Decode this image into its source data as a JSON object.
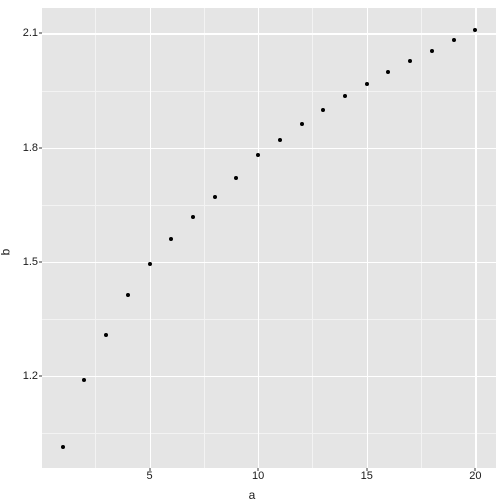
{
  "chart_data": {
    "type": "scatter",
    "xlabel": "a",
    "ylabel": "b",
    "xlim": [
      0.05,
      20.95
    ],
    "ylim": [
      0.958,
      2.167
    ],
    "x_ticks": [
      5,
      10,
      15,
      20
    ],
    "y_ticks": [
      1.2,
      1.5,
      1.8,
      2.1
    ],
    "x_minor": [
      2.5,
      7.5,
      12.5,
      17.5
    ],
    "y_minor": [
      1.05,
      1.35,
      1.65,
      1.95
    ],
    "x": [
      1,
      2,
      3,
      4,
      5,
      6,
      7,
      8,
      9,
      10,
      11,
      12,
      13,
      14,
      15,
      16,
      17,
      18,
      19,
      20
    ],
    "y": [
      1.013,
      1.189,
      1.308,
      1.413,
      1.495,
      1.56,
      1.617,
      1.67,
      1.72,
      1.78,
      1.82,
      1.863,
      1.9,
      1.935,
      1.967,
      1.998,
      2.028,
      2.055,
      2.083,
      2.11
    ]
  }
}
